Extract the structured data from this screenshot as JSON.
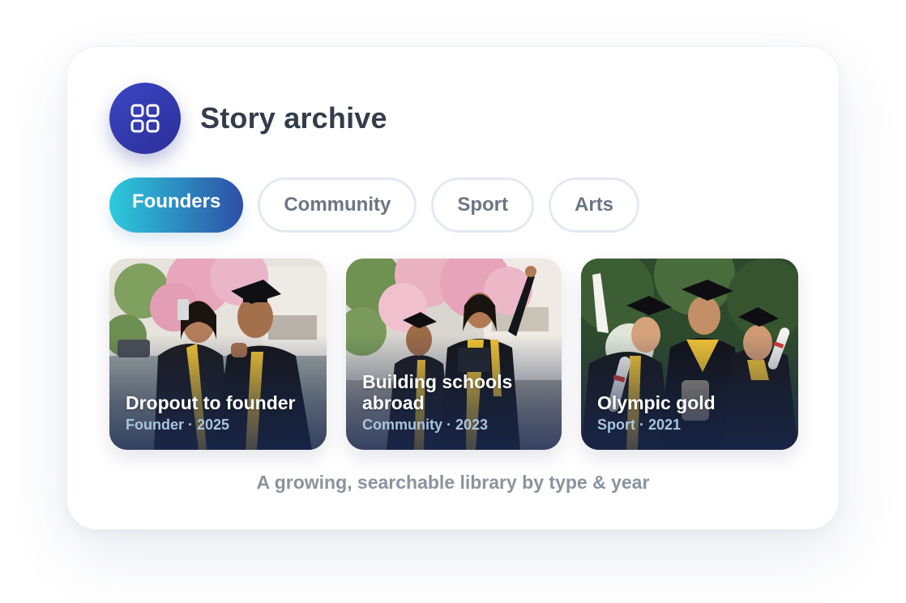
{
  "header": {
    "title": "Story archive",
    "icon": "grid-icon",
    "icon_color": "#3a46c4"
  },
  "tabs": [
    {
      "label": "Founders",
      "active": true
    },
    {
      "label": "Community",
      "active": false
    },
    {
      "label": "Sport",
      "active": false
    },
    {
      "label": "Arts",
      "active": false
    }
  ],
  "stories": [
    {
      "title": "Dropout to founder",
      "category": "Founder",
      "year": "2025",
      "meta": "Founder · 2025",
      "image": "graduates-selfie-photo"
    },
    {
      "title": "Building schools abroad",
      "category": "Community",
      "year": "2023",
      "meta": "Community · 2023",
      "image": "graduates-cherry-blossom-photo"
    },
    {
      "title": "Olympic gold",
      "category": "Sport",
      "year": "2021",
      "meta": "Sport · 2021",
      "image": "graduates-diplomas-photo"
    }
  ],
  "caption": "A growing, searchable library by type & year",
  "colors": {
    "accent_gradient_start": "#2ccbdc",
    "accent_gradient_end": "#2d4fa6",
    "title_text": "#333d4b",
    "muted_text": "#8a939e"
  }
}
